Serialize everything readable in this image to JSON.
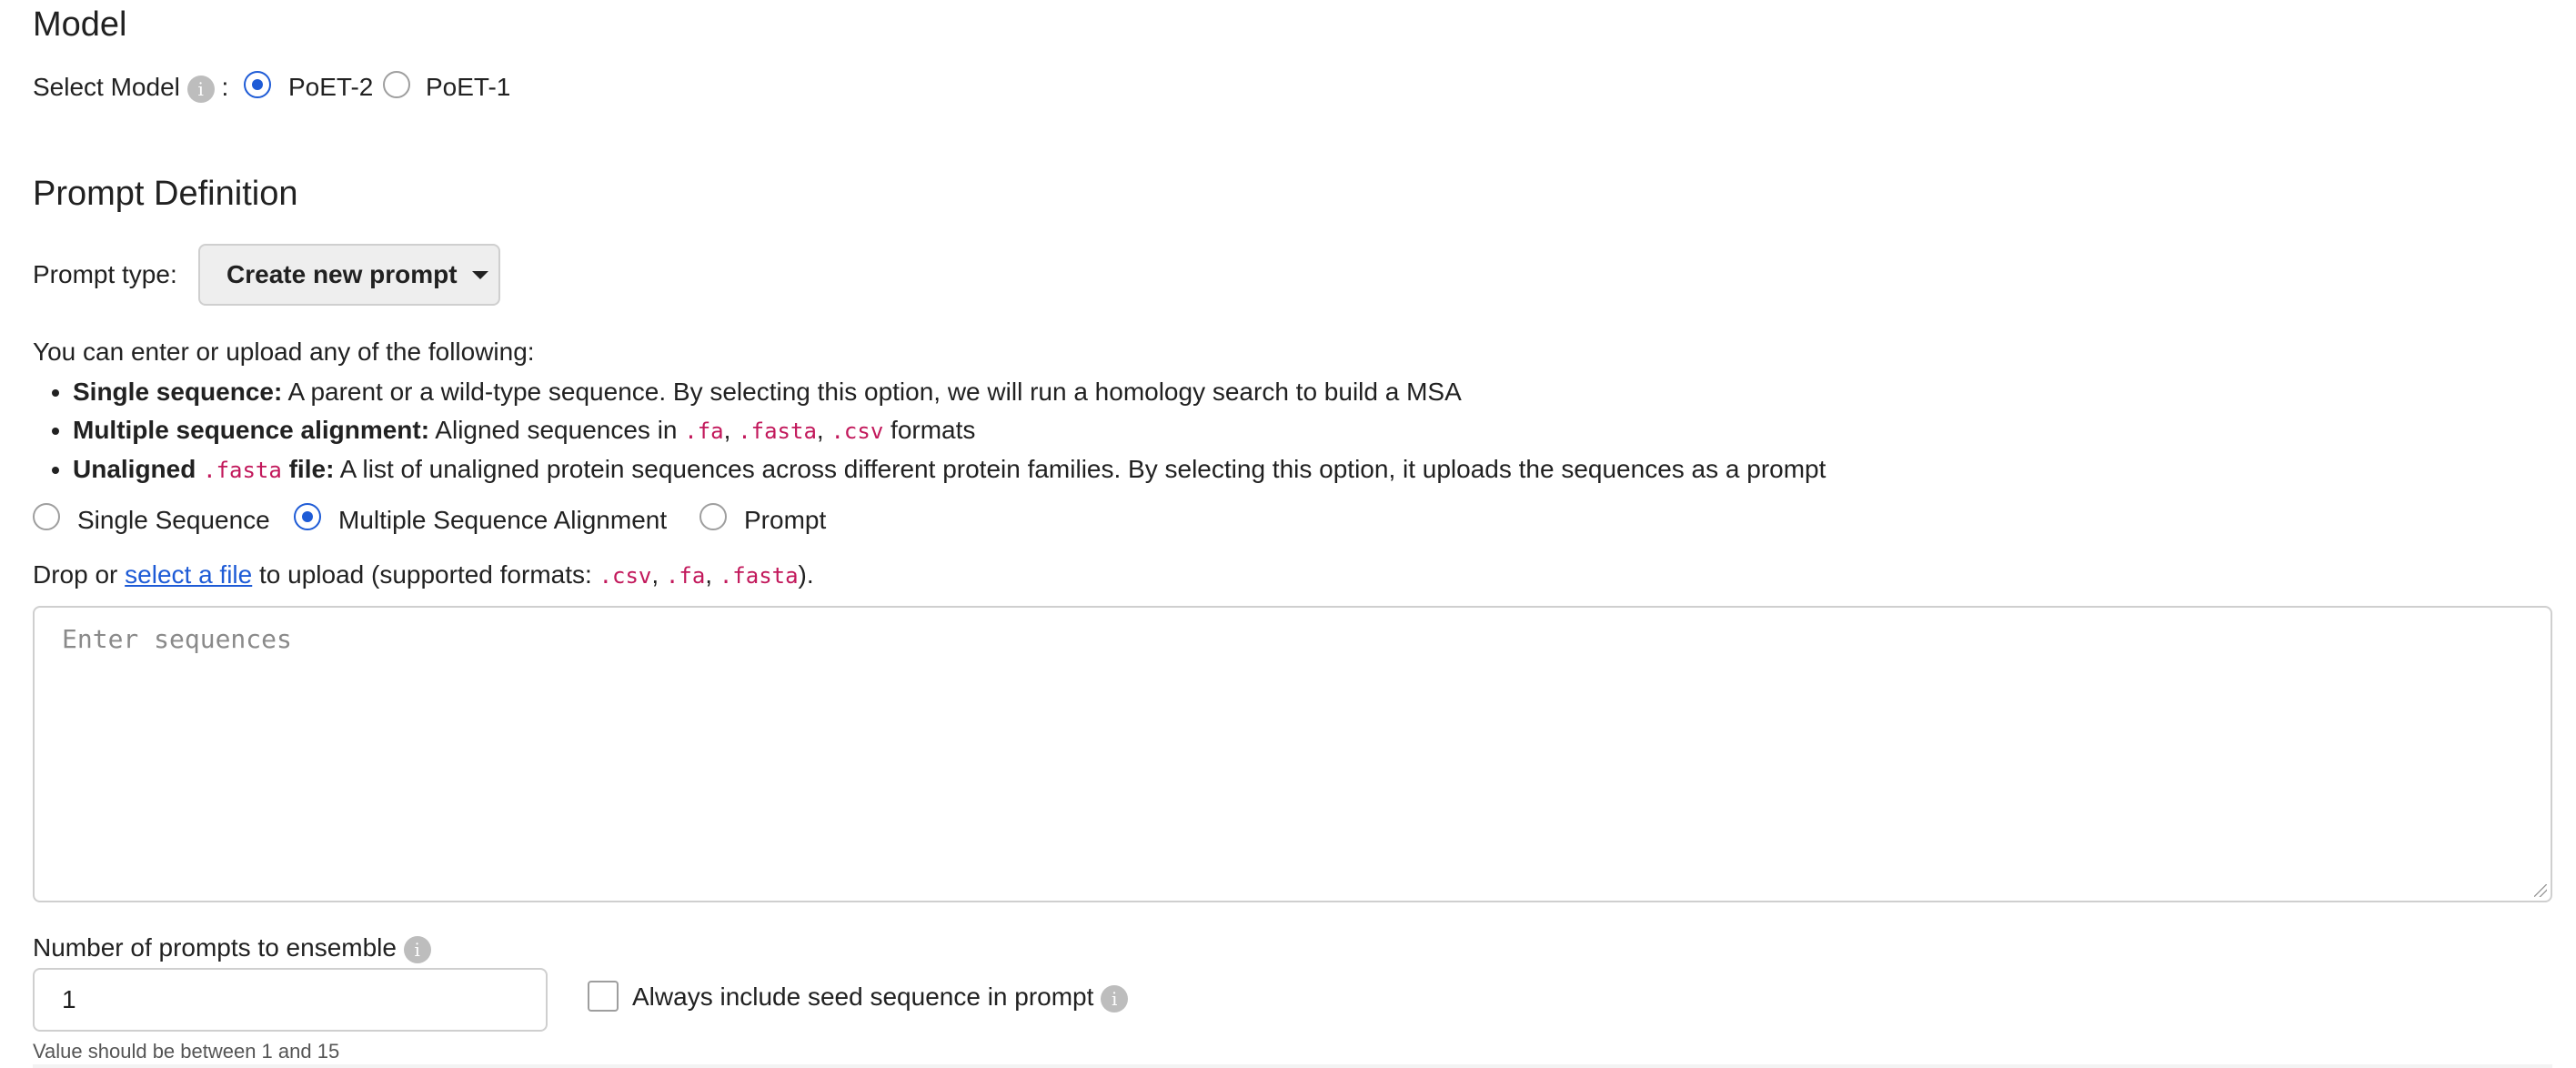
{
  "model_section": {
    "heading": "Model",
    "select_label": "Select Model",
    "colon": ":",
    "info_glyph": "i",
    "options": [
      {
        "label": "PoET-2",
        "checked": true
      },
      {
        "label": "PoET-1",
        "checked": false
      }
    ]
  },
  "prompt_section": {
    "heading": "Prompt Definition",
    "type_label": "Prompt type:",
    "type_value": "Create new prompt",
    "intro": "You can enter or upload any of the following:",
    "bullets": [
      {
        "bold": "Single sequence:",
        "text": " A parent or a wild-type sequence. By selecting this option, we will run a homology search to build a MSA"
      },
      {
        "bold": "Multiple sequence alignment:",
        "text_1": " Aligned sequences in ",
        "code_1": ".fa",
        "sep_1": ", ",
        "code_2": ".fasta",
        "sep_2": ", ",
        "code_3": ".csv",
        "text_2": " formats"
      },
      {
        "bold_1": "Unaligned ",
        "code": ".fasta",
        "bold_2": " file:",
        "text": " A list of unaligned protein sequences across different protein families. By selecting this option, it uploads the sequences as a prompt"
      }
    ],
    "input_types": [
      {
        "label": "Single Sequence",
        "checked": false
      },
      {
        "label": "Multiple Sequence Alignment",
        "checked": true
      },
      {
        "label": "Prompt",
        "checked": false
      }
    ],
    "upload": {
      "prefix": "Drop or ",
      "link": "select a file",
      "middle": " to upload (supported formats: ",
      "formats": [
        ".csv",
        ".fa",
        ".fasta"
      ],
      "sep": ", ",
      "suffix": ")."
    },
    "sequences_placeholder": "Enter sequences"
  },
  "ensemble": {
    "label": "Number of prompts to ensemble",
    "value": "1",
    "hint": "Value should be between 1 and 15",
    "seed_label": "Always include seed sequence in prompt",
    "seed_checked": false
  },
  "colors": {
    "accent": "#1e5bd6",
    "code": "#c2185b",
    "border": "#cfcfcf",
    "info_bg": "#bdbdbd"
  },
  "icons": [
    "info-icon",
    "caret-down-icon",
    "resize-handle-icon"
  ]
}
